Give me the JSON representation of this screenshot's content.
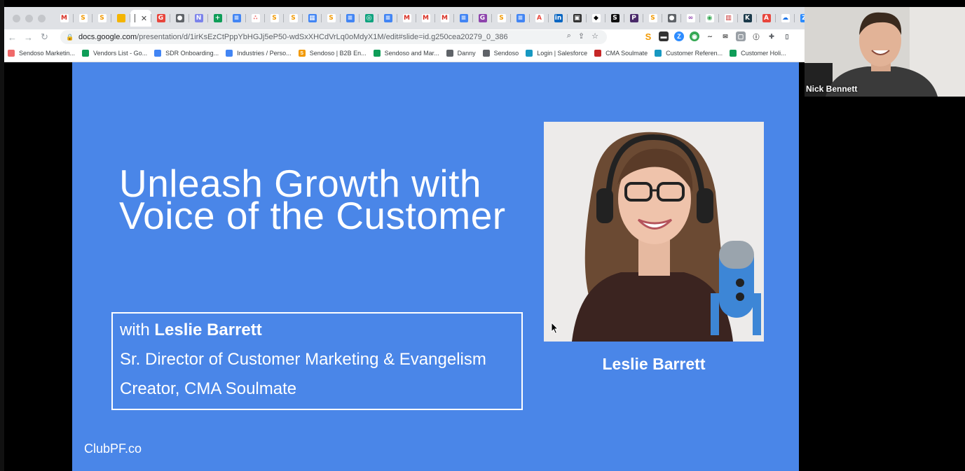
{
  "browser": {
    "tabs": [
      {
        "icon": "gmail-icon",
        "glyph": "M",
        "color": "#ffffff",
        "fg": "#d93025"
      },
      {
        "icon": "sendoso-icon",
        "glyph": "S",
        "color": "#ffffff",
        "fg": "#f29900"
      },
      {
        "icon": "sendoso-icon",
        "glyph": "S",
        "color": "#ffffff",
        "fg": "#f29900"
      },
      {
        "icon": "slides-icon",
        "glyph": "",
        "color": "#f4b400",
        "fg": "#ffffff"
      },
      {
        "icon": "active-tab",
        "glyph": "",
        "color": "",
        "fg": ""
      },
      {
        "icon": "g-red-icon",
        "glyph": "G",
        "color": "#e8453c",
        "fg": "#ffffff"
      },
      {
        "icon": "globe-icon",
        "glyph": "●",
        "color": "#5f6368",
        "fg": "#ffffff"
      },
      {
        "icon": "doc-purple-icon",
        "glyph": "N",
        "color": "#7b83eb",
        "fg": "#ffffff"
      },
      {
        "icon": "sheets-icon",
        "glyph": "+",
        "color": "#0f9d58",
        "fg": "#ffffff"
      },
      {
        "icon": "docs-icon",
        "glyph": "≡",
        "color": "#4285f4",
        "fg": "#ffffff"
      },
      {
        "icon": "asana-icon",
        "glyph": "∴",
        "color": "#ffffff",
        "fg": "#f06a6a"
      },
      {
        "icon": "sendoso-icon",
        "glyph": "S",
        "color": "#ffffff",
        "fg": "#f29900"
      },
      {
        "icon": "sendoso-icon",
        "glyph": "S",
        "color": "#ffffff",
        "fg": "#f29900"
      },
      {
        "icon": "calendar-icon",
        "glyph": "▦",
        "color": "#4285f4",
        "fg": "#ffffff"
      },
      {
        "icon": "sendoso-icon",
        "glyph": "S",
        "color": "#ffffff",
        "fg": "#f29900"
      },
      {
        "icon": "docs-icon",
        "glyph": "≡",
        "color": "#4285f4",
        "fg": "#ffffff"
      },
      {
        "icon": "openai-icon",
        "glyph": "◎",
        "color": "#10a37f",
        "fg": "#ffffff"
      },
      {
        "icon": "docs-icon",
        "glyph": "≡",
        "color": "#4285f4",
        "fg": "#ffffff"
      },
      {
        "icon": "gmail-icon",
        "glyph": "M",
        "color": "#ffffff",
        "fg": "#d93025"
      },
      {
        "icon": "gmail-icon",
        "glyph": "M",
        "color": "#ffffff",
        "fg": "#d93025"
      },
      {
        "icon": "gmail-icon",
        "glyph": "M",
        "color": "#ffffff",
        "fg": "#d93025"
      },
      {
        "icon": "docs-icon",
        "glyph": "≡",
        "color": "#4285f4",
        "fg": "#ffffff"
      },
      {
        "icon": "gong-icon",
        "glyph": "G",
        "color": "#8e44ad",
        "fg": "#ffffff"
      },
      {
        "icon": "sendoso-icon",
        "glyph": "S",
        "color": "#ffffff",
        "fg": "#f29900"
      },
      {
        "icon": "docs-icon",
        "glyph": "≡",
        "color": "#4285f4",
        "fg": "#ffffff"
      },
      {
        "icon": "adobe-icon",
        "glyph": "A",
        "color": "#ffffff",
        "fg": "#e8453c"
      },
      {
        "icon": "linkedin-icon",
        "glyph": "in",
        "color": "#0a66c2",
        "fg": "#ffffff"
      },
      {
        "icon": "image-icon",
        "glyph": "▣",
        "color": "#333333",
        "fg": "#ffffff"
      },
      {
        "icon": "diamond-icon",
        "glyph": "◆",
        "color": "#ffffff",
        "fg": "#000000"
      },
      {
        "icon": "s-black-icon",
        "glyph": "S",
        "color": "#111111",
        "fg": "#ffffff"
      },
      {
        "icon": "p-purple-icon",
        "glyph": "P",
        "color": "#4a2a6a",
        "fg": "#ffffff"
      },
      {
        "icon": "sendoso-icon",
        "glyph": "S",
        "color": "#ffffff",
        "fg": "#f29900"
      },
      {
        "icon": "globe-icon",
        "glyph": "●",
        "color": "#5f6368",
        "fg": "#ffffff"
      },
      {
        "icon": "circles-icon",
        "glyph": "∞",
        "color": "#ffffff",
        "fg": "#8e44ad"
      },
      {
        "icon": "chrome-icon",
        "glyph": "◉",
        "color": "#ffffff",
        "fg": "#34a853"
      },
      {
        "icon": "chart-icon",
        "glyph": "▥",
        "color": "#ffffff",
        "fg": "#c62828"
      },
      {
        "icon": "k-icon",
        "glyph": "K",
        "color": "#1b3a4b",
        "fg": "#ffffff"
      },
      {
        "icon": "af-icon",
        "glyph": "A",
        "color": "#e8453c",
        "fg": "#ffffff"
      },
      {
        "icon": "cloud-icon",
        "glyph": "☁",
        "color": "#ffffff",
        "fg": "#1a73e8"
      },
      {
        "icon": "zoom-icon",
        "glyph": "Z",
        "color": "#2d8cff",
        "fg": "#ffffff"
      }
    ],
    "url_host": "docs.google.com",
    "url_path": "/presentation/d/1irKsEzCtPppYbHGJj5eP50-wdSxXHCdVrLq0oMdyX1M/edit#slide=id.g250cea20279_0_386",
    "bookmarks": [
      {
        "label": "Sendoso Marketin...",
        "icon": "asana-icon",
        "color": "#f06a6a"
      },
      {
        "label": "Vendors List - Go...",
        "icon": "sheets-icon",
        "color": "#0f9d58"
      },
      {
        "label": "SDR Onboarding...",
        "icon": "slides-blue-icon",
        "color": "#4285f4"
      },
      {
        "label": "Industries / Perso...",
        "icon": "docs-icon",
        "color": "#4285f4"
      },
      {
        "label": "Sendoso | B2B En...",
        "icon": "sendoso-icon",
        "color": "#f29900"
      },
      {
        "label": "Sendoso and Mar...",
        "icon": "sheets-icon",
        "color": "#0f9d58"
      },
      {
        "label": "Danny",
        "icon": "folder-icon",
        "color": "#5f6368"
      },
      {
        "label": "Sendoso",
        "icon": "folder-icon",
        "color": "#5f6368"
      },
      {
        "label": "Login | Salesforce",
        "icon": "salesforce-icon",
        "color": "#1798c1"
      },
      {
        "label": "CMA Soulmate",
        "icon": "cma-icon",
        "color": "#c62828"
      },
      {
        "label": "Customer Referen...",
        "icon": "salesforce-icon",
        "color": "#1798c1"
      },
      {
        "label": "Customer Holi...",
        "icon": "sheets-icon",
        "color": "#0f9d58"
      }
    ]
  },
  "slide": {
    "title_line1": "Unleash Growth with",
    "title_line2": "Voice of the Customer",
    "with_prefix": "with ",
    "speaker_name": "Leslie Barrett",
    "role_line": "Sr. Director of Customer Marketing &  Evangelism",
    "creator_line": "Creator, CMA Soulmate",
    "caption": "Leslie Barrett",
    "footer": "ClubPF.co",
    "background": "#4a86e8"
  },
  "webcam": {
    "participant_name": "Nick Bennett"
  }
}
